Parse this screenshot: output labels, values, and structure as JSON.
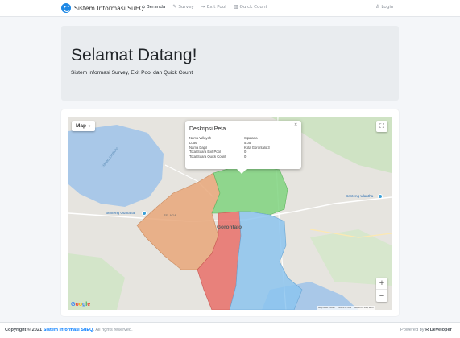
{
  "navbar": {
    "brand": "Sistem Informasi SuEQ",
    "items": [
      {
        "label": "Beranda",
        "icon": "home-icon",
        "glyph": "⌂",
        "active": true
      },
      {
        "label": "Survey",
        "icon": "edit-icon",
        "glyph": "✎",
        "active": false
      },
      {
        "label": "Exit Pool",
        "icon": "exit-icon",
        "glyph": "⇥",
        "active": false
      },
      {
        "label": "Quick Count",
        "icon": "chart-icon",
        "glyph": "▥",
        "active": false
      }
    ],
    "login": {
      "label": "Login",
      "icon": "user-icon",
      "glyph": "♙"
    }
  },
  "jumbotron": {
    "title": "Selamat Datang!",
    "subtitle": "Sistem informasi Survey, Exit Pool dan Quick Count"
  },
  "map": {
    "type_control": "Map",
    "labels": {
      "lake": "Danau Limboto",
      "city": "Gorontalo",
      "district": "TELAGA",
      "poi_1": "Benteng Otanaha",
      "poi_2": "Benteng Ulantha"
    },
    "zoom_in": "+",
    "zoom_out": "−",
    "fullscreen_icon": "⛶",
    "google_logo": [
      "G",
      "o",
      "o",
      "g",
      "l",
      "e"
    ],
    "attribution": [
      "Map data ©2021",
      "Terms of Use",
      "Report a map error"
    ],
    "colors": {
      "water": "#a9c8e8",
      "land": "#e6e4df",
      "region_orange": "#e8a77a",
      "region_green": "#7fd47f",
      "region_red": "#e8706a",
      "region_blue": "#8cc4ee"
    },
    "info_window": {
      "title": "Deskripsi Peta",
      "close": "×",
      "rows": [
        {
          "key": "Nama Wilayah",
          "value": "Sipatana"
        },
        {
          "key": "Luas",
          "value": "5.05"
        },
        {
          "key": "Nama Dapil",
          "value": "Kota Gorontalo 3"
        },
        {
          "key": "Total Suara Exit Pool",
          "value": "0"
        },
        {
          "key": "Total Suara Quick Count",
          "value": "0"
        }
      ]
    }
  },
  "footer": {
    "copyright_prefix": "Copyright © 2021",
    "copyright_link": "Sistem Informasi SuEQ",
    "copyright_suffix": ". All rights reserved.",
    "powered_prefix": "Powered by",
    "powered_name": "R Developer"
  }
}
